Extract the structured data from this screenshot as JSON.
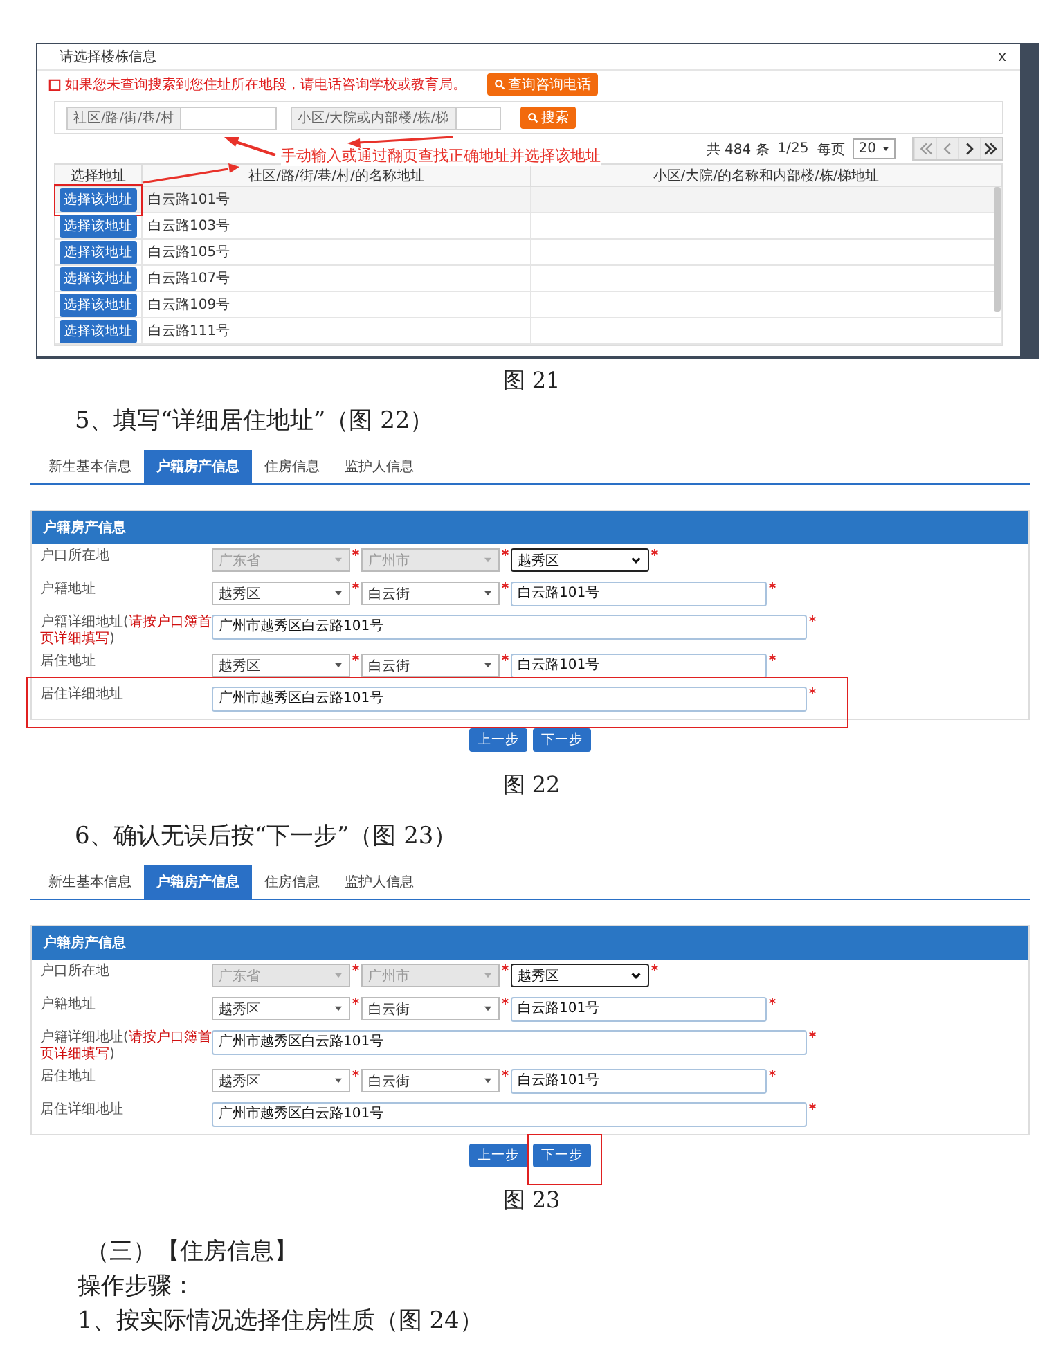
{
  "dialog_figure": {
    "title": "请选择楼栋信息",
    "close": "x",
    "notice": "如果您未查询搜索到您住址所在地段，请电话咨询学校或教育局。",
    "notice_button": "查询咨询电话",
    "search": [
      {
        "label": "社区/路/街/巷/村"
      },
      {
        "label": "小区/大院或内部楼/栋/梯"
      }
    ],
    "search_button": "搜索",
    "pager": {
      "total": "共 484 条",
      "page": "1/25",
      "per_page_label": "每页",
      "per_page": "20"
    },
    "annotation": "手动输入或通过翻页查找正确地址并选择该地址",
    "columns": [
      "选择地址",
      "社区/路/街/巷/村/的名称地址",
      "小区/大院/的名称和内部楼/栋/梯地址"
    ],
    "rows": [
      {
        "button": "选择该地址",
        "address": "白云路101号",
        "highlighted": true
      },
      {
        "button": "选择该地址",
        "address": "白云路103号",
        "highlighted": false
      },
      {
        "button": "选择该地址",
        "address": "白云路105号",
        "highlighted": false
      },
      {
        "button": "选择该地址",
        "address": "白云路107号",
        "highlighted": false
      },
      {
        "button": "选择该地址",
        "address": "白云路109号",
        "highlighted": false
      },
      {
        "button": "选择该地址",
        "address": "白云路111号",
        "highlighted": false
      }
    ],
    "caption": "图 21"
  },
  "form_figures": [
    {
      "step": "5、填写“详细居住地址”（图 22）",
      "tabs": [
        {
          "label": "新生基本信息",
          "selected": false
        },
        {
          "label": "户籍房产信息",
          "selected": true
        },
        {
          "label": "住房信息",
          "selected": false
        },
        {
          "label": "监护人信息",
          "selected": false
        }
      ],
      "panel_title": "户籍房产信息",
      "rows": [
        {
          "kind": "selects",
          "label": "户口所在地",
          "selects": [
            {
              "value": "广东省",
              "disabled": true
            },
            {
              "value": "广州市",
              "disabled": true
            },
            {
              "value": "越秀区",
              "disabled": false
            }
          ],
          "highlighted": false
        },
        {
          "kind": "select_input",
          "label": "户籍地址",
          "selects": [
            {
              "value": "越秀区",
              "disabled": false
            },
            {
              "value": "白云街",
              "disabled": false
            }
          ],
          "input": "白云路101号",
          "highlighted": false
        },
        {
          "kind": "input",
          "label": "户籍详细地址(",
          "note": "请按户口簿首页详细填写",
          "label_end": ")",
          "input": "广州市越秀区白云路101号",
          "highlighted": false
        },
        {
          "kind": "select_input",
          "label": "居住地址",
          "selects": [
            {
              "value": "越秀区",
              "disabled": false
            },
            {
              "value": "白云街",
              "disabled": false
            }
          ],
          "input": "白云路101号",
          "highlighted": false
        },
        {
          "kind": "input",
          "label": "居住详细地址",
          "input": "广州市越秀区白云路101号",
          "highlighted": true
        }
      ],
      "buttons": [
        {
          "label": "上一步",
          "highlighted": false
        },
        {
          "label": "下一步",
          "highlighted": false
        }
      ],
      "caption": "图 22"
    },
    {
      "step": "6、确认无误后按“下一步”（图 23）",
      "tabs": [
        {
          "label": "新生基本信息",
          "selected": false
        },
        {
          "label": "户籍房产信息",
          "selected": true
        },
        {
          "label": "住房信息",
          "selected": false
        },
        {
          "label": "监护人信息",
          "selected": false
        }
      ],
      "panel_title": "户籍房产信息",
      "rows": [
        {
          "kind": "selects",
          "label": "户口所在地",
          "selects": [
            {
              "value": "广东省",
              "disabled": true
            },
            {
              "value": "广州市",
              "disabled": true
            },
            {
              "value": "越秀区",
              "disabled": false
            }
          ],
          "highlighted": false
        },
        {
          "kind": "select_input",
          "label": "户籍地址",
          "selects": [
            {
              "value": "越秀区",
              "disabled": false
            },
            {
              "value": "白云街",
              "disabled": false
            }
          ],
          "input": "白云路101号",
          "highlighted": false
        },
        {
          "kind": "input",
          "label": "户籍详细地址(",
          "note": "请按户口簿首页详细填写",
          "label_end": ")",
          "input": "广州市越秀区白云路101号",
          "highlighted": false
        },
        {
          "kind": "select_input",
          "label": "居住地址",
          "selects": [
            {
              "value": "越秀区",
              "disabled": false
            },
            {
              "value": "白云街",
              "disabled": false
            }
          ],
          "input": "白云路101号",
          "highlighted": false
        },
        {
          "kind": "input",
          "label": "居住详细地址",
          "input": "广州市越秀区白云路101号",
          "highlighted": false
        }
      ],
      "buttons": [
        {
          "label": "上一步",
          "highlighted": false
        },
        {
          "label": "下一步",
          "highlighted": true
        }
      ],
      "caption": "图 23"
    }
  ],
  "section_title": "（三）【住房信息】",
  "steps_label": "操作步骤：",
  "next_step": "1、按实际情况选择住房性质（图 24）"
}
